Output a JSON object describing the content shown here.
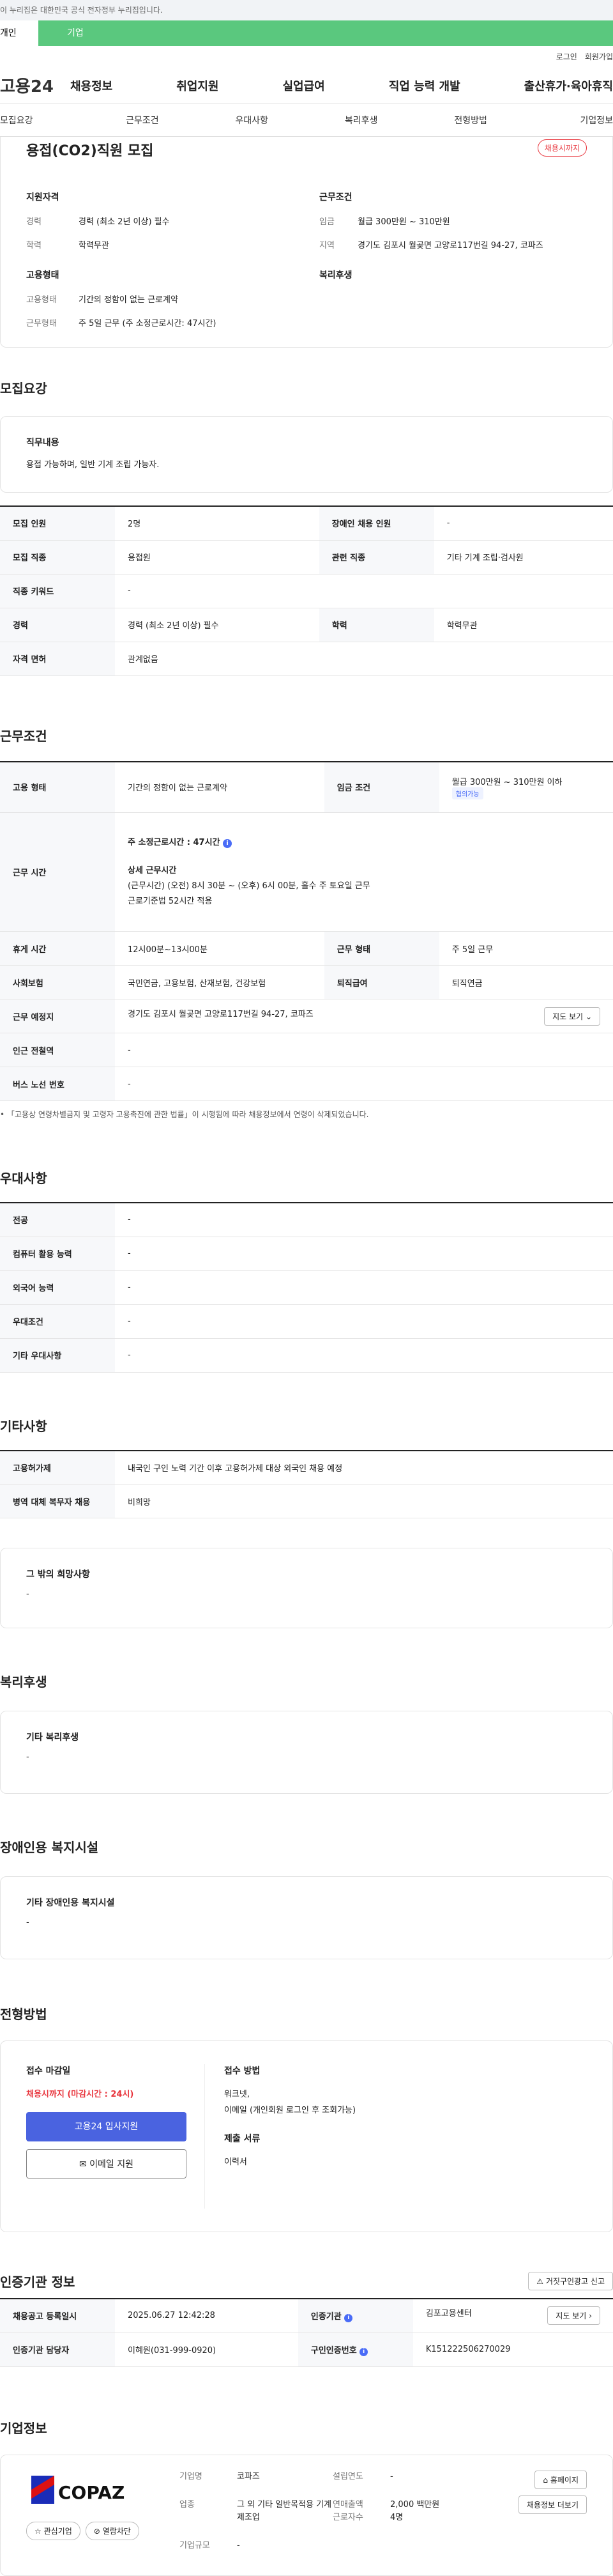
{
  "gov_notice": "이 누리집은 대한민국 공식 전자정부 누리집입니다.",
  "user_tabs": [
    "개인",
    "기업"
  ],
  "util": [
    "로그인",
    "회원가입"
  ],
  "logo": "고용24",
  "gnb": [
    "채용정보",
    "취업지원",
    "실업급여",
    "직업 능력 개발",
    "출산휴가·육아휴직"
  ],
  "subnav": [
    "모집요강",
    "근무조건",
    "우대사항",
    "복리후생",
    "전형방법",
    "기업정보"
  ],
  "summary": {
    "title": "용접(CO2)직원 모집",
    "badge": "채용시까지",
    "qual_title": "지원자격",
    "cond_title": "근무조건",
    "type_title": "고용형태",
    "welfare_title": "복리후생",
    "qual": [
      {
        "k": "경력",
        "v": "경력 (최소 2년 이상) 필수"
      },
      {
        "k": "학력",
        "v": "학력무관"
      }
    ],
    "cond": [
      {
        "k": "임금",
        "v": "월급 300만원 ~ 310만원"
      },
      {
        "k": "지역",
        "v": "경기도 김포시 월곶면 고양로117번길 94-27, 코파즈"
      }
    ],
    "type": [
      {
        "k": "고용형태",
        "v": "기간의 정함이 없는 근로계약"
      },
      {
        "k": "근무형태",
        "v": "주 5일 근무 (주 소정근로시간: 47시간)"
      }
    ]
  },
  "recruit": {
    "heading": "모집요강",
    "duty_title": "직무내용",
    "duty": "용접 가능하며, 일반 기계 조립 가능자.",
    "rows": [
      [
        "모집 인원",
        "2명",
        "장애인 채용 인원",
        "-"
      ],
      [
        "모집 직종",
        "용접원",
        "관련 직종",
        "기타 기계 조립·검사원"
      ],
      [
        "직종 키워드",
        "-"
      ],
      [
        "경력",
        "경력 (최소 2년 이상) 필수",
        "학력",
        "학력무관"
      ],
      [
        "자격 면허",
        "관계없음"
      ]
    ]
  },
  "work": {
    "heading": "근무조건",
    "type_k": "고용 형태",
    "type_v": "기간의 정함이 없는 근로계약",
    "wage_k": "임금 조건",
    "wage_v": "월급 300만원 ~ 310만원 이하",
    "wage_tag": "협의가능",
    "hours_k": "근무 시간",
    "hours_main": "주 소정근로시간 : 47시간",
    "hours_sub_title": "상세 근무시간",
    "hours_detail_1": "(근무시간) (오전) 8시 30분 ~ (오후) 6시 00분, 홀수 주 토요일 근무",
    "hours_detail_2": "근로기준법 52시간 적용",
    "rest_k": "휴게 시간",
    "rest_v": "12시00분~13시00분",
    "form_k": "근무 형태",
    "form_v": "주 5일 근무",
    "ins_k": "사회보험",
    "ins_v": "국민연금, 고용보험, 산재보험, 건강보험",
    "sev_k": "퇴직급여",
    "sev_v": "퇴직연금",
    "place_k": "근무 예정지",
    "place_v": "경기도 김포시 월곶면 고양로117번길 94-27, 코파즈",
    "map_btn": "지도 보기",
    "subway_k": "인근 전철역",
    "subway_v": "-",
    "bus_k": "버스 노선 번호",
    "bus_v": "-",
    "note": "「고용상 연령차별금지 및 고령자 고용촉진에 관한 법률」이 시행됨에 따라 채용정보에서 연령이 삭제되었습니다."
  },
  "pref": {
    "heading": "우대사항",
    "rows": [
      [
        "전공",
        "-"
      ],
      [
        "컴퓨터 활용 능력",
        "-"
      ],
      [
        "외국어 능력",
        "-"
      ],
      [
        "우대조건",
        "-"
      ],
      [
        "기타 우대사항",
        "-"
      ]
    ]
  },
  "etc": {
    "heading": "기타사항",
    "rows": [
      [
        "고용허가제",
        "내국인 구인 노력 기간 이후 고용허가제 대상 외국인 채용 예정"
      ],
      [
        "병역 대체 복무자 채용",
        "비희망"
      ]
    ],
    "other_title": "그 밖의 희망사항",
    "other_v": "-"
  },
  "welfare": {
    "heading": "복리후생",
    "title": "기타 복리후생",
    "v": "-"
  },
  "disabled": {
    "heading": "장애인용 복지시설",
    "title": "기타 장애인용 복지시설",
    "v": "-"
  },
  "process": {
    "heading": "전형방법",
    "deadline_t": "접수 마감일",
    "deadline_v": "채용시까지 (마감시간 : 24시)",
    "apply_btn": "고용24 입사지원",
    "email_btn": "이메일 지원",
    "method_t": "접수 방법",
    "method_v1": "워크넷,",
    "method_v2": "이메일 (개인회원 로그인 후 조회가능)",
    "doc_t": "제출 서류",
    "doc_v": "이력서"
  },
  "cert": {
    "heading": "인증기관 정보",
    "report_btn": "거짓구인광고 신고",
    "r1": [
      "채용공고 등록일시",
      "2025.06.27 12:42:28",
      "인증기관",
      "김포고용센터"
    ],
    "r2": [
      "인증기관 담당자",
      "이혜원(031-999-0920)",
      "구인인증번호",
      "K151222506270029"
    ],
    "more_btn": "지도 보기"
  },
  "company": {
    "heading": "기업정보",
    "logo_text": "COPAZ",
    "fav_btn": "관심기업",
    "block_btn": "열람차단",
    "rows": [
      [
        "기업명",
        "코파즈",
        "설립연도",
        "-"
      ],
      [
        "업종",
        "그 외 기타 일반목적용 기계 제조업",
        "연매출액",
        "2,000 백만원"
      ],
      [
        "",
        "",
        "근로자수",
        "4명"
      ],
      [
        "기업규모",
        "-",
        "",
        ""
      ]
    ],
    "home_btn": "홈페이지",
    "more_btn": "채용정보 더보기"
  }
}
